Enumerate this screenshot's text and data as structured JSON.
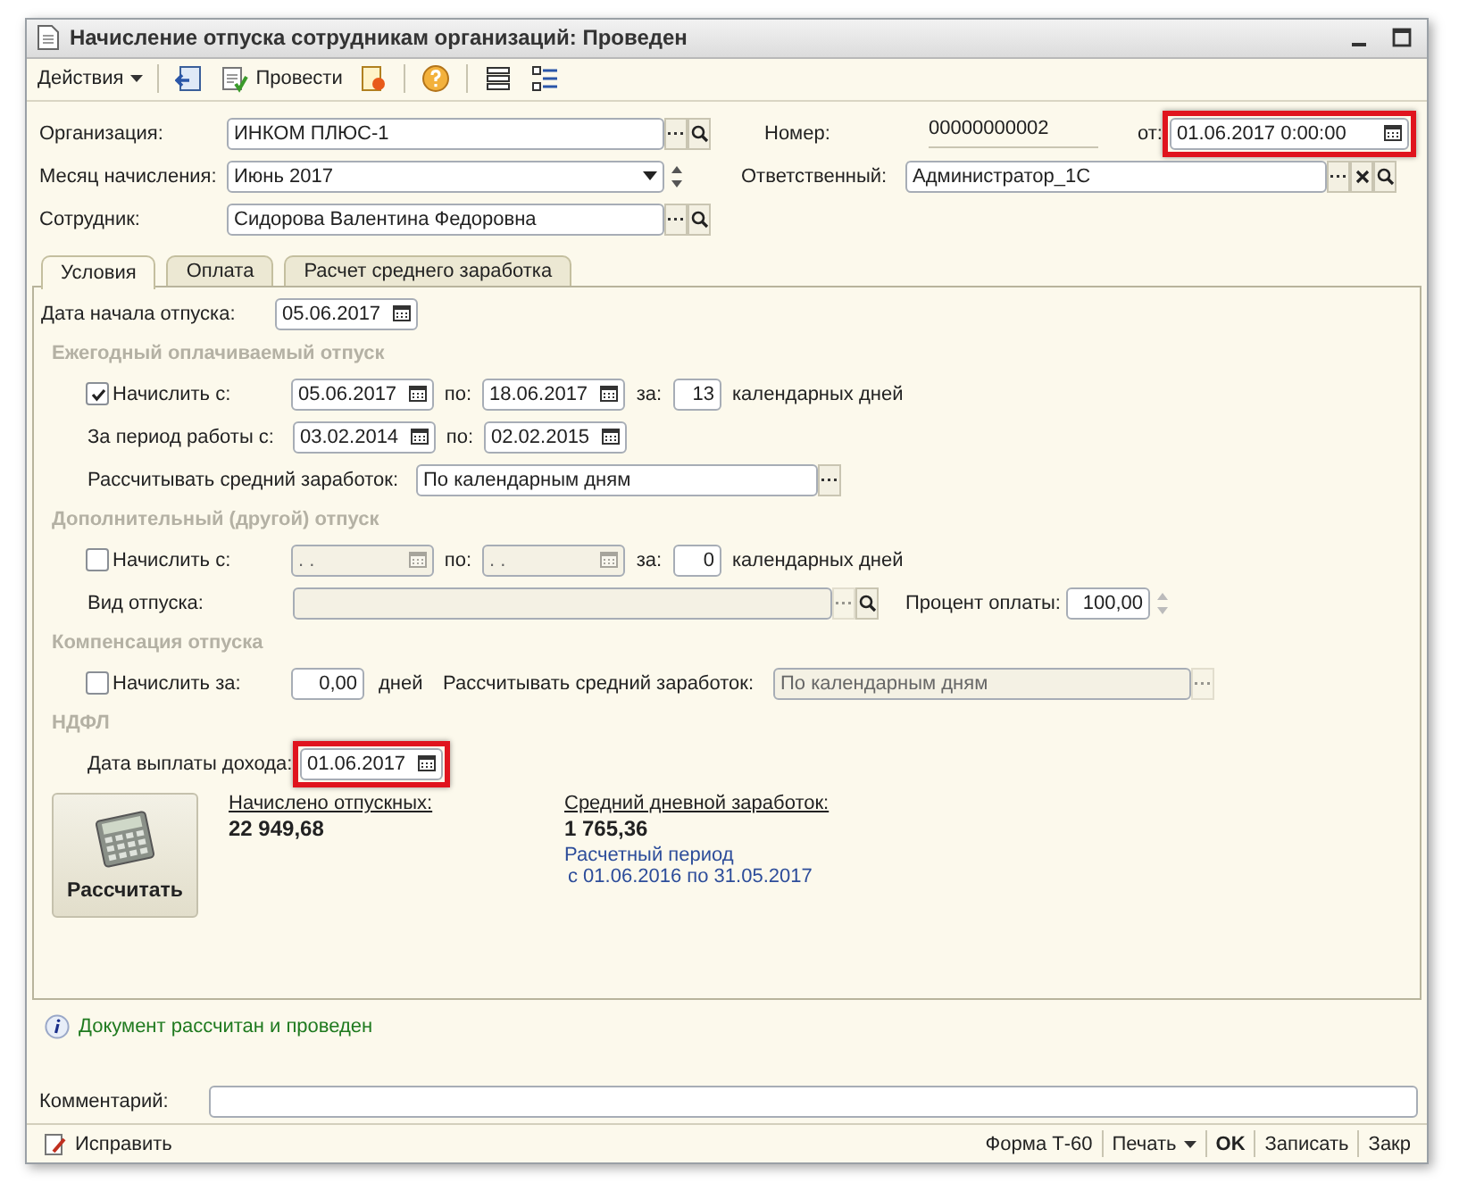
{
  "window": {
    "title": "Начисление отпуска сотрудникам организаций: Проведен"
  },
  "toolbar": {
    "actions": "Действия",
    "post": "Провести"
  },
  "header": {
    "organization": {
      "label": "Организация:",
      "value": "ИНКОМ ПЛЮС-1"
    },
    "number": {
      "label": "Номер:",
      "value": "00000000002"
    },
    "date": {
      "label": "от:",
      "value": "01.06.2017  0:00:00",
      "highlighted": true
    },
    "month": {
      "label": "Месяц начисления:",
      "value": "Июнь 2017"
    },
    "responsible": {
      "label": "Ответственный:",
      "value": "Администратор_1С"
    },
    "employee": {
      "label": "Сотрудник:",
      "value": "Сидорова Валентина Федоровна"
    }
  },
  "tabs": [
    {
      "label": "Условия",
      "selected": true
    },
    {
      "label": "Оплата",
      "selected": false
    },
    {
      "label": "Расчет среднего заработка",
      "selected": false
    }
  ],
  "start_date": {
    "label": "Дата начала отпуска:",
    "value": "05.06.2017"
  },
  "annual": {
    "title": "Ежегодный оплачиваемый отпуск",
    "accrue": {
      "checked": true,
      "label": "Начислить с:",
      "from": "05.06.2017",
      "to_label": "по:",
      "to": "18.06.2017",
      "days_label": "за:",
      "days": "13",
      "unit": "календарных дней",
      "disabled": false
    },
    "period": {
      "label": "За период работы с:",
      "from": "03.02.2014",
      "to_label": "по:",
      "to": "02.02.2015"
    },
    "average": {
      "label": "Рассчитывать средний заработок:",
      "value": "По календарным дням",
      "disabled": false
    }
  },
  "additional": {
    "title": "Дополнительный (другой) отпуск",
    "accrue": {
      "checked": false,
      "label": "Начислить с:",
      "from": ". .",
      "to_label": "по:",
      "to": ". .",
      "days_label": "за:",
      "days": "0",
      "unit": "календарных дней",
      "disabled": true
    },
    "type": {
      "label": "Вид отпуска:"
    },
    "percent": {
      "label": "Процент оплаты:",
      "value": "100,00"
    }
  },
  "compensation": {
    "title": "Компенсация отпуска",
    "accrue": {
      "checked": false,
      "label": "Начислить за:",
      "days": "0,00",
      "unit": "дней"
    },
    "average": {
      "label": "Рассчитывать средний заработок:",
      "value": "По календарным дням",
      "disabled": true
    }
  },
  "ndfl": {
    "title": "НДФЛ",
    "pay_date": {
      "label": "Дата выплаты дохода:",
      "value": "01.06.2017",
      "highlighted": true
    }
  },
  "calculate": "Рассчитать",
  "results": {
    "accrued": {
      "label": "Начислено отпускных:",
      "value": "22 949,68"
    },
    "average": {
      "label": "Средний дневной заработок:",
      "value": "1 765,36",
      "period_label": "Расчетный период",
      "period": "с 01.06.2016 по 31.05.2017"
    }
  },
  "message": "Документ рассчитан и проведен",
  "comment": {
    "label": "Комментарий:"
  },
  "footer": [
    {
      "kind": "fix",
      "label": "Исправить"
    },
    {
      "kind": "plain",
      "label": "Форма Т-60"
    },
    {
      "kind": "menu",
      "label": "Печать"
    },
    {
      "kind": "default",
      "label": "OK"
    },
    {
      "kind": "plain",
      "label": "Записать"
    },
    {
      "kind": "plain",
      "label": "Закр"
    }
  ]
}
